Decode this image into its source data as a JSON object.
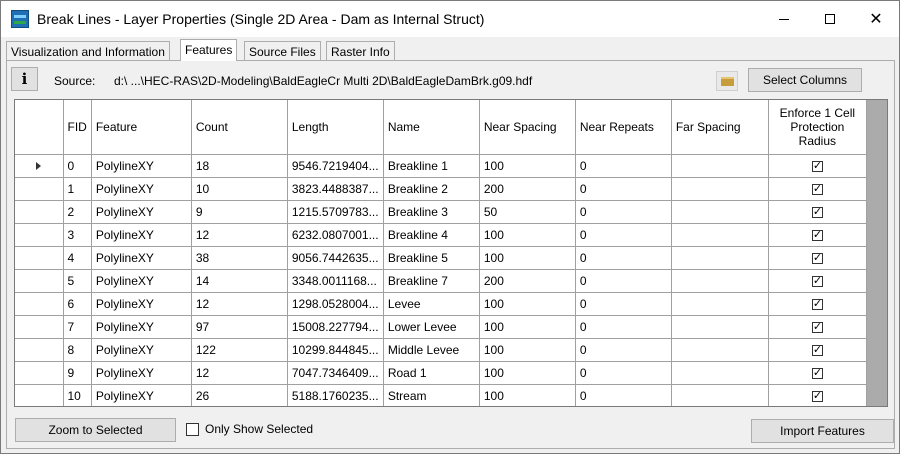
{
  "window": {
    "title": "Break Lines - Layer Properties (Single 2D Area - Dam as Internal Struct)"
  },
  "tabs": [
    {
      "label": "Visualization and Information",
      "active": false
    },
    {
      "label": "Features",
      "active": true
    },
    {
      "label": "Source Files",
      "active": false
    },
    {
      "label": "Raster Info",
      "active": false
    }
  ],
  "toolbar": {
    "info_label": "i",
    "source_label": "Source:",
    "source_path": "d:\\ ...\\HEC-RAS\\2D-Modeling\\BaldEagleCr Multi 2D\\BaldEagleDamBrk.g09.hdf",
    "select_columns_label": "Select Columns"
  },
  "table": {
    "columns": [
      "FID",
      "Feature",
      "Count",
      "Length",
      "Name",
      "Near Spacing",
      "Near Repeats",
      "Far Spacing",
      "Enforce 1 Cell Protection Radius"
    ],
    "rows": [
      {
        "fid": "0",
        "feature": "PolylineXY",
        "count": "18",
        "length": "9546.7219404...",
        "name": "Breakline 1",
        "near_spacing": "100",
        "near_repeats": "0",
        "far_spacing": "",
        "enforce": true,
        "current": true
      },
      {
        "fid": "1",
        "feature": "PolylineXY",
        "count": "10",
        "length": "3823.4488387...",
        "name": "Breakline 2",
        "near_spacing": "200",
        "near_repeats": "0",
        "far_spacing": "",
        "enforce": true,
        "current": false
      },
      {
        "fid": "2",
        "feature": "PolylineXY",
        "count": "9",
        "length": "1215.5709783...",
        "name": "Breakline 3",
        "near_spacing": "50",
        "near_repeats": "0",
        "far_spacing": "",
        "enforce": true,
        "current": false
      },
      {
        "fid": "3",
        "feature": "PolylineXY",
        "count": "12",
        "length": "6232.0807001...",
        "name": "Breakline 4",
        "near_spacing": "100",
        "near_repeats": "0",
        "far_spacing": "",
        "enforce": true,
        "current": false
      },
      {
        "fid": "4",
        "feature": "PolylineXY",
        "count": "38",
        "length": "9056.7442635...",
        "name": "Breakline 5",
        "near_spacing": "100",
        "near_repeats": "0",
        "far_spacing": "",
        "enforce": true,
        "current": false
      },
      {
        "fid": "5",
        "feature": "PolylineXY",
        "count": "14",
        "length": "3348.0011168...",
        "name": "Breakline 7",
        "near_spacing": "200",
        "near_repeats": "0",
        "far_spacing": "",
        "enforce": true,
        "current": false
      },
      {
        "fid": "6",
        "feature": "PolylineXY",
        "count": "12",
        "length": "1298.0528004...",
        "name": "Levee",
        "near_spacing": "100",
        "near_repeats": "0",
        "far_spacing": "",
        "enforce": true,
        "current": false
      },
      {
        "fid": "7",
        "feature": "PolylineXY",
        "count": "97",
        "length": "15008.227794...",
        "name": "Lower Levee",
        "near_spacing": "100",
        "near_repeats": "0",
        "far_spacing": "",
        "enforce": true,
        "current": false
      },
      {
        "fid": "8",
        "feature": "PolylineXY",
        "count": "122",
        "length": "10299.844845...",
        "name": "Middle Levee",
        "near_spacing": "100",
        "near_repeats": "0",
        "far_spacing": "",
        "enforce": true,
        "current": false
      },
      {
        "fid": "9",
        "feature": "PolylineXY",
        "count": "12",
        "length": "7047.7346409...",
        "name": "Road 1",
        "near_spacing": "100",
        "near_repeats": "0",
        "far_spacing": "",
        "enforce": true,
        "current": false
      },
      {
        "fid": "10",
        "feature": "PolylineXY",
        "count": "26",
        "length": "5188.1760235...",
        "name": "Stream",
        "near_spacing": "100",
        "near_repeats": "0",
        "far_spacing": "",
        "enforce": true,
        "current": false
      }
    ]
  },
  "footer": {
    "zoom_label": "Zoom to Selected",
    "only_show_label": "Only Show Selected",
    "only_show_checked": false,
    "import_label": "Import Features"
  }
}
